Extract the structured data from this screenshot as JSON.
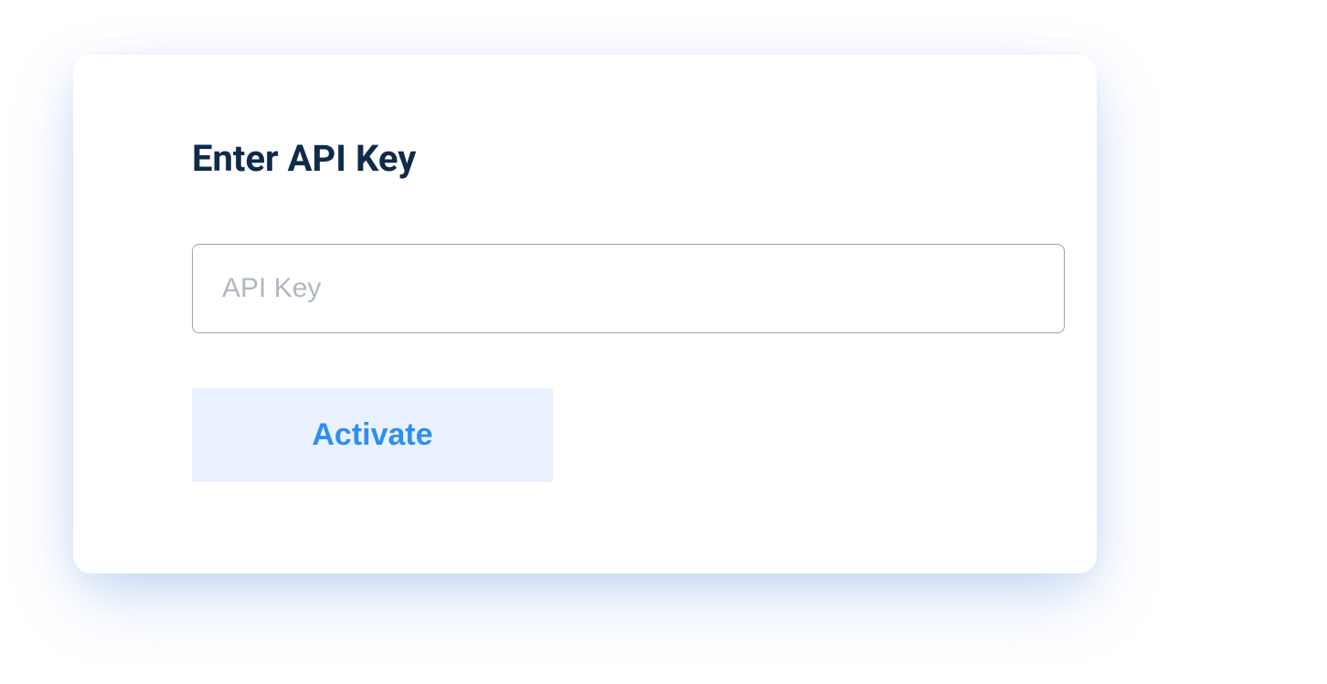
{
  "card": {
    "title": "Enter API Key",
    "input": {
      "placeholder": "API Key",
      "value": ""
    },
    "button_label": "Activate"
  }
}
